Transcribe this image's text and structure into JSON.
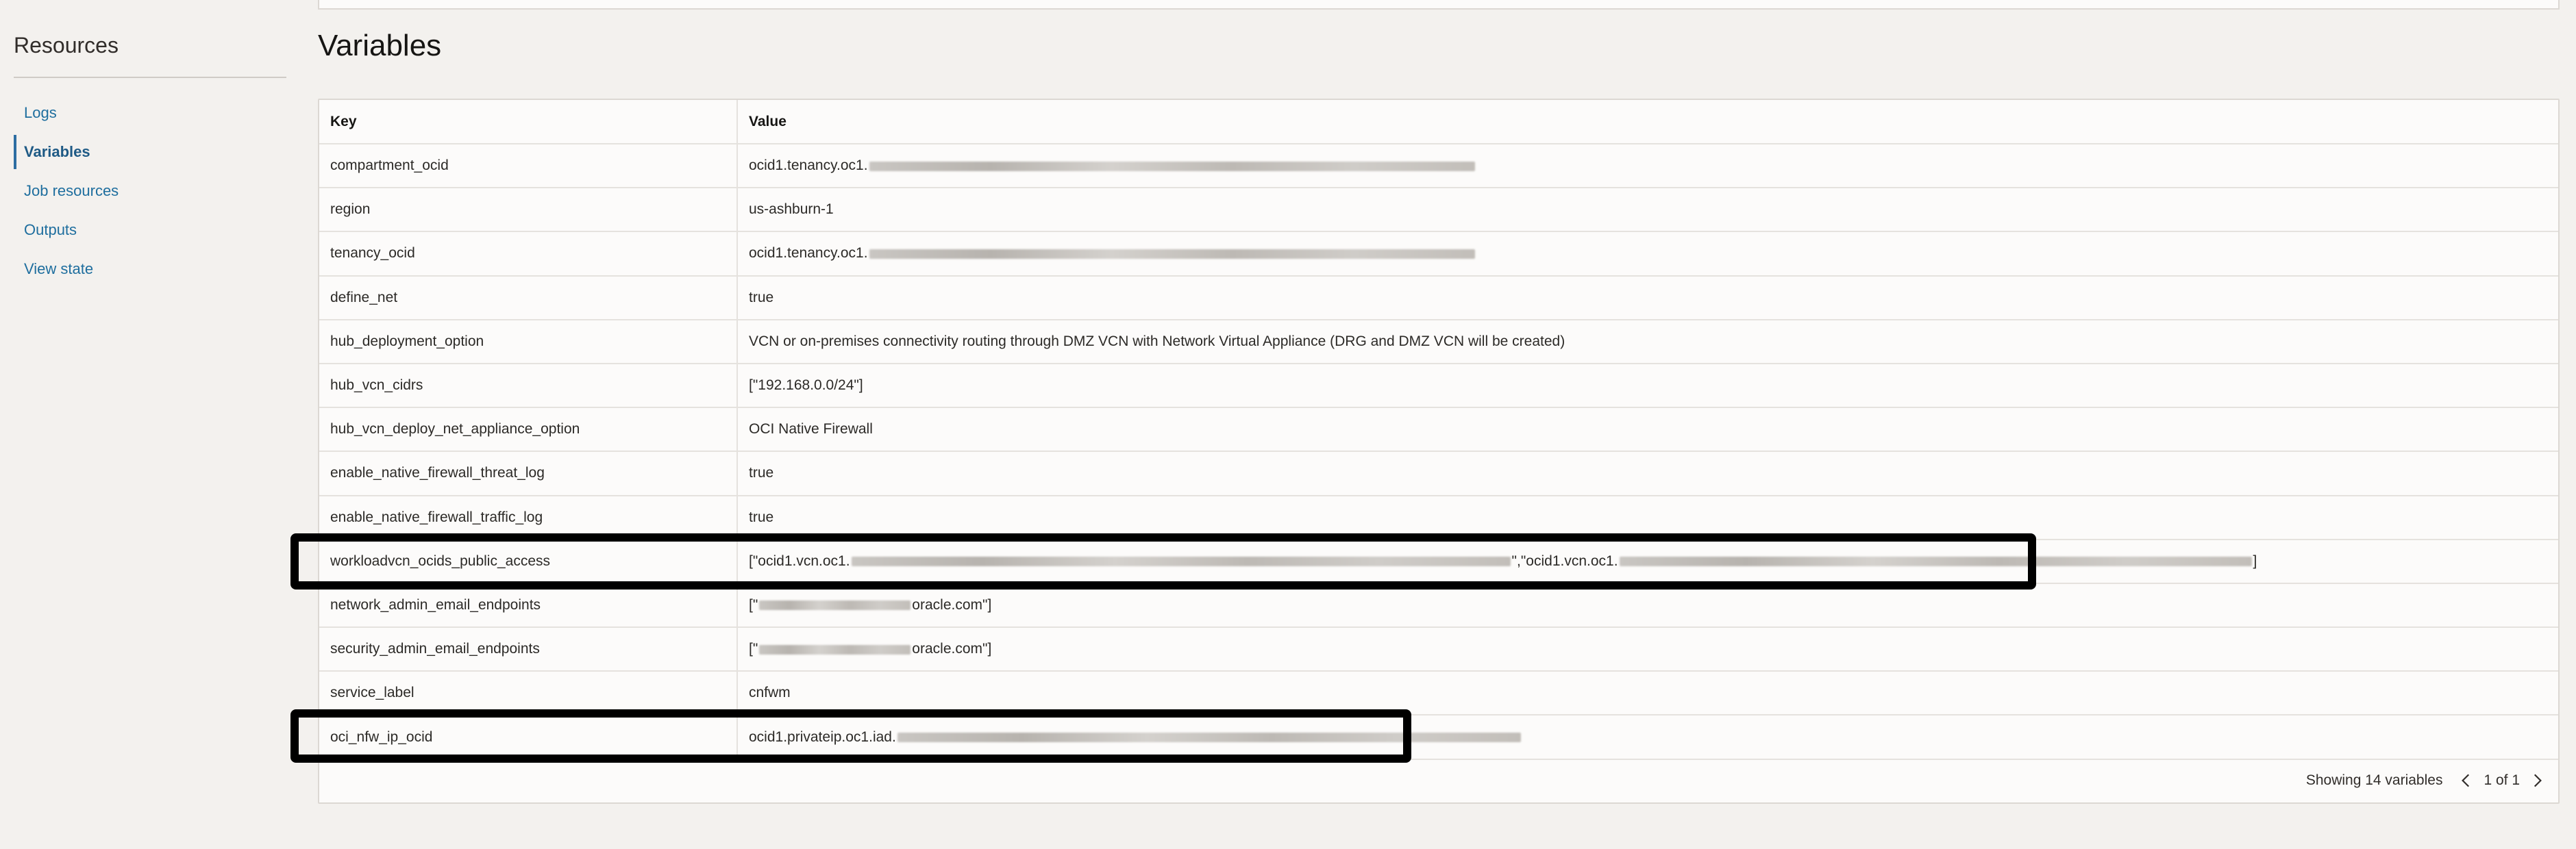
{
  "sidebar": {
    "title": "Resources",
    "items": [
      {
        "label": "Logs",
        "active": false
      },
      {
        "label": "Variables",
        "active": true
      },
      {
        "label": "Job resources",
        "active": false
      },
      {
        "label": "Outputs",
        "active": false
      },
      {
        "label": "View state",
        "active": false
      }
    ]
  },
  "main": {
    "heading": "Variables",
    "columns": {
      "key": "Key",
      "value": "Value"
    },
    "rows": [
      {
        "key": "compartment_ocid",
        "value_prefix": "ocid1.tenancy.oc1.",
        "value_suffix": "",
        "redact": [
          680
        ]
      },
      {
        "key": "region",
        "value_prefix": "us-ashburn-1",
        "value_suffix": "",
        "redact": []
      },
      {
        "key": "tenancy_ocid",
        "value_prefix": "ocid1.tenancy.oc1.",
        "value_suffix": "",
        "redact": [
          680
        ]
      },
      {
        "key": "define_net",
        "value_prefix": "true",
        "value_suffix": "",
        "redact": []
      },
      {
        "key": "hub_deployment_option",
        "value_prefix": "VCN or on-premises connectivity routing through DMZ VCN with Network Virtual Appliance (DRG and DMZ VCN will be created)",
        "value_suffix": "",
        "redact": []
      },
      {
        "key": "hub_vcn_cidrs",
        "value_prefix": "[\"192.168.0.0/24\"]",
        "value_suffix": "",
        "redact": []
      },
      {
        "key": "hub_vcn_deploy_net_appliance_option",
        "value_prefix": "OCI Native Firewall",
        "value_suffix": "",
        "redact": []
      },
      {
        "key": "enable_native_firewall_threat_log",
        "value_prefix": "true",
        "value_suffix": "",
        "redact": []
      },
      {
        "key": "enable_native_firewall_traffic_log",
        "value_prefix": "true",
        "value_suffix": "",
        "redact": []
      },
      {
        "key": "workloadvcn_ocids_public_access",
        "value_prefix": "[\"ocid1.vcn.oc1.",
        "value_middle": "\",\"ocid1.vcn.oc1.",
        "value_suffix": "]",
        "redact": [
          740,
          710
        ]
      },
      {
        "key": "network_admin_email_endpoints",
        "value_prefix": "[\"",
        "value_suffix": "oracle.com\"]",
        "redact": [
          170
        ]
      },
      {
        "key": "security_admin_email_endpoints",
        "value_prefix": "[\"",
        "value_suffix": "oracle.com\"]",
        "redact": [
          170
        ]
      },
      {
        "key": "service_label",
        "value_prefix": "cnfwm",
        "value_suffix": "",
        "redact": []
      },
      {
        "key": "oci_nfw_ip_ocid",
        "value_prefix": "ocid1.privateip.oc1.iad.",
        "value_suffix": "",
        "redact": [
          700
        ]
      }
    ],
    "footer": {
      "count_text": "Showing 14 variables",
      "page_text": "1 of 1"
    }
  },
  "colors": {
    "background": "#f3f1ee",
    "link": "#1e6e9e",
    "highlight_border": "#000000"
  }
}
